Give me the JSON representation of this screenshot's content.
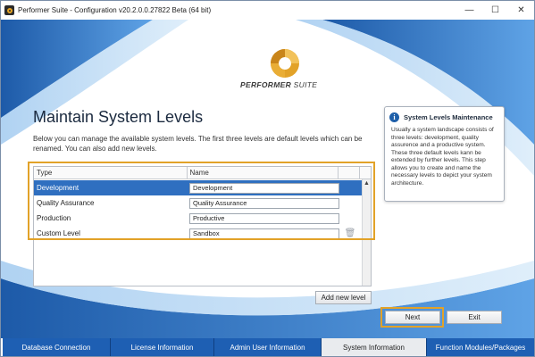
{
  "window": {
    "title": "Performer Suite - Configuration v20.2.0.0.27822 Beta (64 bit)",
    "controls": {
      "minimize": "—",
      "maximize": "☐",
      "close": "✕"
    }
  },
  "branding": {
    "prefix": "PERFORMER",
    "suffix": " SUITE"
  },
  "page": {
    "heading": "Maintain System Levels",
    "description": "Below you can manage the available system levels. The first three levels are default levels which can be renamed. You can also add new levels."
  },
  "table": {
    "columns": [
      "Type",
      "Name"
    ],
    "rows": [
      {
        "type": "Development",
        "name": "Development",
        "selected": true,
        "deletable": false
      },
      {
        "type": "Quality Assurance",
        "name": "Quality Assurance",
        "selected": false,
        "deletable": false
      },
      {
        "type": "Production",
        "name": "Productive",
        "selected": false,
        "deletable": false
      },
      {
        "type": "Custom Level",
        "name": "Sandbox",
        "selected": false,
        "deletable": true
      }
    ]
  },
  "buttons": {
    "add_level": "Add new level",
    "next": "Next",
    "exit": "Exit"
  },
  "info": {
    "title": "System Levels Maintenance",
    "body": "Usually a system landscape consists of three levels: development, quality assurence and a productive system. These three default levels kann be extended by further levels. This step allows you to create and name the necessary levels to depict your system architecture."
  },
  "tabs": [
    {
      "label": "Database Connection",
      "active": false
    },
    {
      "label": "License Information",
      "active": false
    },
    {
      "label": "Admin User Information",
      "active": false
    },
    {
      "label": "System Information",
      "active": true
    },
    {
      "label": "Function Modules/Packages",
      "active": false
    }
  ],
  "colors": {
    "accent": "#e2a228",
    "selection": "#2f6fc0",
    "tab_blue": "#1e5fb3"
  }
}
